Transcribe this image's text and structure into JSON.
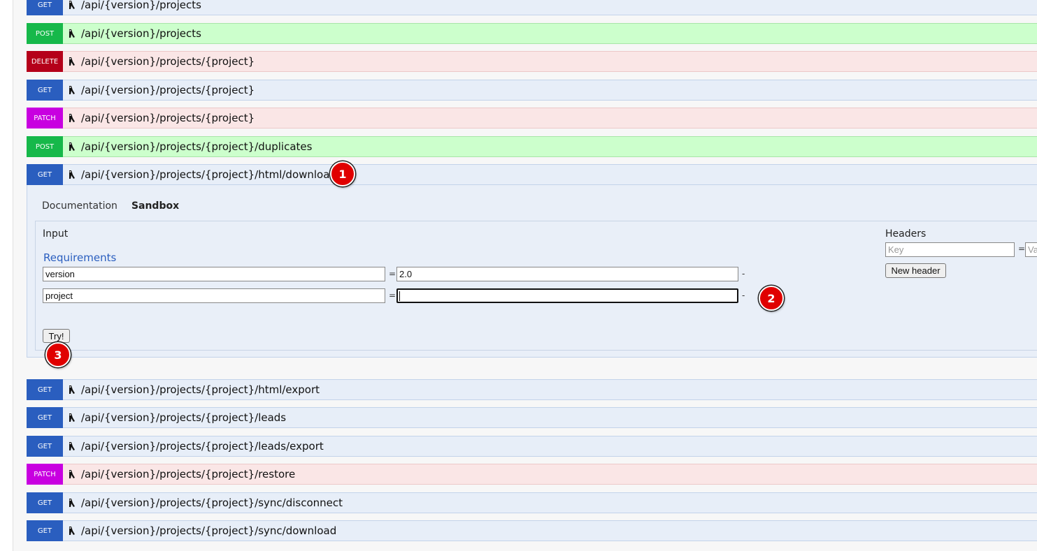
{
  "routes_top": [
    {
      "method": "GET",
      "path": "/api/{version}/projects"
    },
    {
      "method": "POST",
      "path": "/api/{version}/projects"
    },
    {
      "method": "DELETE",
      "path": "/api/{version}/projects/{project}"
    },
    {
      "method": "GET",
      "path": "/api/{version}/projects/{project}"
    },
    {
      "method": "PATCH",
      "path": "/api/{version}/projects/{project}"
    },
    {
      "method": "POST",
      "path": "/api/{version}/projects/{project}/duplicates"
    },
    {
      "method": "GET",
      "path": "/api/{version}/projects/{project}/html/download"
    }
  ],
  "sandbox": {
    "tab_documentation": "Documentation",
    "tab_sandbox": "Sandbox",
    "input_label": "Input",
    "requirements_label": "Requirements",
    "params": [
      {
        "name": "version",
        "value": "2.0"
      },
      {
        "name": "project",
        "value": ""
      }
    ],
    "equals": "=",
    "dash": "-",
    "try_label": "Try!",
    "headers_label": "Headers",
    "header_key_placeholder": "Key",
    "header_value_placeholder": "Value",
    "new_header_label": "New header"
  },
  "routes_bottom": [
    {
      "method": "GET",
      "path": "/api/{version}/projects/{project}/html/export"
    },
    {
      "method": "GET",
      "path": "/api/{version}/projects/{project}/leads"
    },
    {
      "method": "GET",
      "path": "/api/{version}/projects/{project}/leads/export"
    },
    {
      "method": "PATCH",
      "path": "/api/{version}/projects/{project}/restore"
    },
    {
      "method": "GET",
      "path": "/api/{version}/projects/{project}/sync/disconnect"
    },
    {
      "method": "GET",
      "path": "/api/{version}/projects/{project}/sync/download"
    }
  ],
  "markers": [
    "1",
    "2",
    "3"
  ],
  "colors": {
    "get": "#2a5ebf",
    "post": "#16b84a",
    "delete": "#b5001a",
    "patch": "#c800e0",
    "marker": "#e00000"
  }
}
